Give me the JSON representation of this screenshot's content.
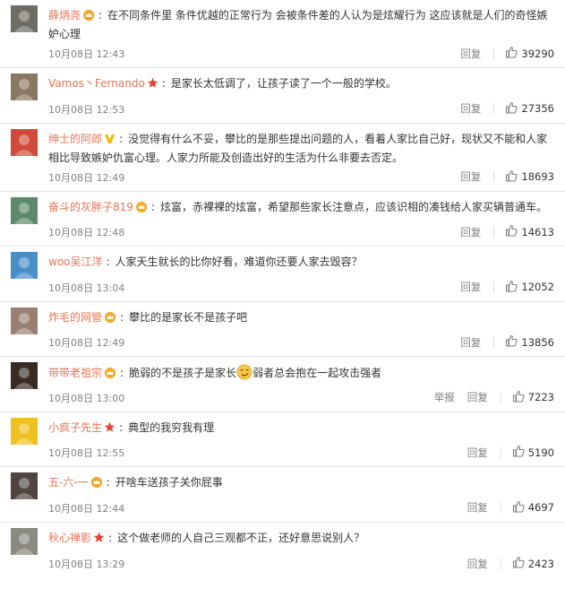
{
  "comments": [
    {
      "name": "薛炳尧",
      "badge": "crown-icon",
      "text": "在不同条件里 条件优越的正常行为 会被条件差的人认为是炫耀行为 这应该就是人们的奇怪嫉妒心理",
      "time": "10月08日 12:43",
      "actions": [
        "回复"
      ],
      "likes": "39290",
      "avatar": "#6d6d66"
    },
    {
      "name": "Vamos丶Fernando",
      "badge": "star-icon",
      "text": "是家长太低调了，让孩子读了一个一般的学校。",
      "time": "10月08日 12:53",
      "actions": [
        "回复"
      ],
      "likes": "27356",
      "avatar": "#8a7860"
    },
    {
      "name": "绅士的阿郎",
      "badge": "vip-v-icon",
      "text": "没觉得有什么不妥，攀比的是那些提出问题的人，看着人家比自己好，现状又不能和人家相比导致嫉妒仇富心理。人家力所能及创造出好的生活为什么非要去否定。",
      "time": "10月08日 12:49",
      "actions": [
        "回复"
      ],
      "likes": "18693",
      "avatar": "#d04a3a"
    },
    {
      "name": "奋斗的灰胖子819",
      "badge": "crown-icon",
      "text": "炫富，赤裸裸的炫富，希望那些家长注意点，应该识相的凑钱给人家买辆普通车。",
      "time": "10月08日 12:48",
      "actions": [
        "回复"
      ],
      "likes": "14613",
      "avatar": "#5f8a6a"
    },
    {
      "name": "woo吴江洋",
      "badge": "",
      "text": "人家天生就长的比你好看，难道你还要人家去毁容？",
      "time": "10月08日 13:04",
      "actions": [
        "回复"
      ],
      "likes": "12052",
      "avatar": "#4a8ec7"
    },
    {
      "name": "炸毛的网管",
      "badge": "crown-icon",
      "text": "攀比的是家长不是孩子吧",
      "time": "10月08日 12:49",
      "actions": [
        "回复"
      ],
      "likes": "13856",
      "avatar": "#9a8070"
    },
    {
      "name": "带带老祖宗",
      "badge": "crown-icon",
      "text_before": "脆弱的不是孩子是家长",
      "emoji": "smirk-emoji-icon",
      "text_after": "弱者总会抱在一起攻击强者",
      "time": "10月08日 13:00",
      "actions": [
        "举报",
        "回复"
      ],
      "likes": "7223",
      "avatar": "#3a2a24"
    },
    {
      "name": "小疯子先生",
      "badge": "star-icon",
      "text": "典型的我穷我有理",
      "time": "10月08日 12:55",
      "actions": [
        "回复"
      ],
      "likes": "5190",
      "avatar": "#f0c020"
    },
    {
      "name": "五-六-一",
      "badge": "crown-icon",
      "text": "开啥车送孩子关你屁事",
      "time": "10月08日 12:44",
      "actions": [
        "回复"
      ],
      "likes": "4697",
      "avatar": "#504540"
    },
    {
      "name": "秋心禅影",
      "badge": "star-icon",
      "text": "这个做老师的人自己三观都不正，还好意思说别人？",
      "time": "10月08日 13:29",
      "actions": [
        "回复"
      ],
      "likes": "2423",
      "avatar": "#8a8a80"
    }
  ],
  "colors": {
    "name": "#eb7350",
    "meta": "#808080",
    "crown": "#f5a623",
    "star": "#e8402a",
    "v": "#f5b800"
  }
}
